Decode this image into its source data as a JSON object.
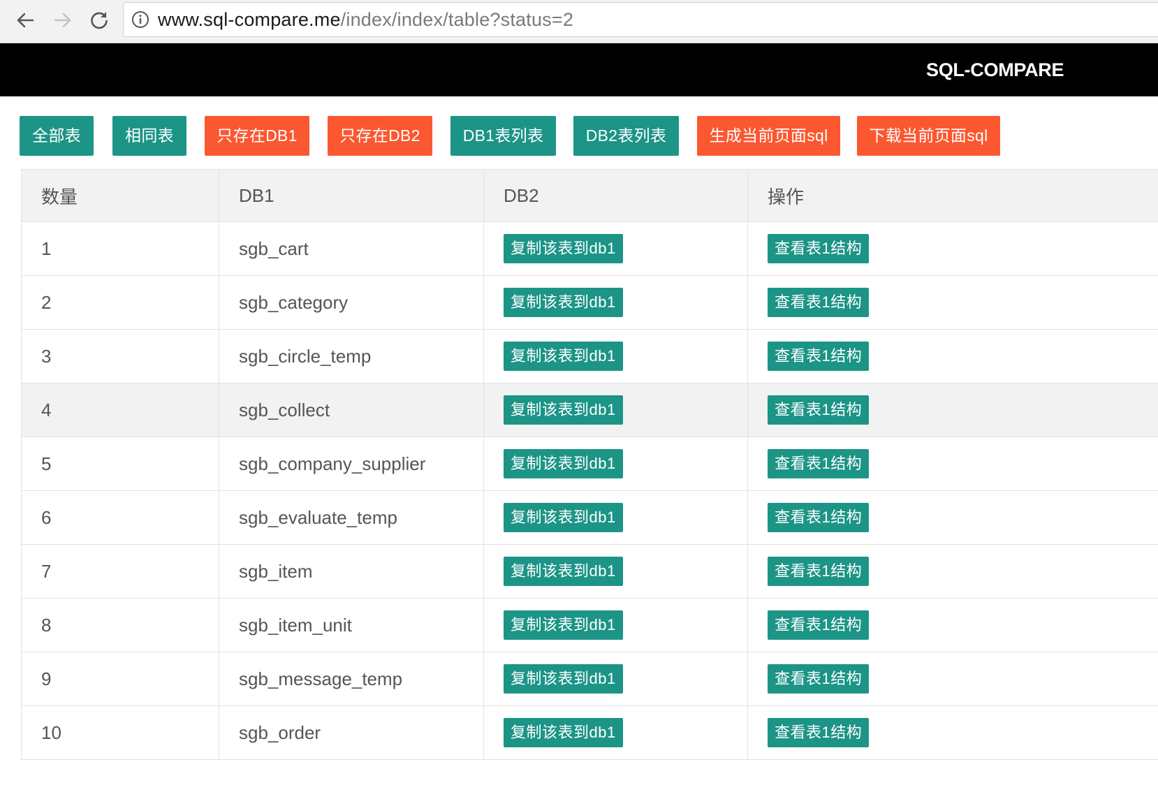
{
  "browser": {
    "url_host": "www.sql-compare.me",
    "url_path": "/index/index/table?status=2"
  },
  "header": {
    "brand": "SQL-COMPARE"
  },
  "toolbar": {
    "buttons": [
      {
        "label": "全部表",
        "color": "#1c9486"
      },
      {
        "label": "相同表",
        "color": "#1c9486"
      },
      {
        "label": "只存在DB1",
        "color": "#fb5730"
      },
      {
        "label": "只存在DB2",
        "color": "#fb5730"
      },
      {
        "label": "DB1表列表",
        "color": "#1c9486"
      },
      {
        "label": "DB2表列表",
        "color": "#1c9486"
      },
      {
        "label": "生成当前页面sql",
        "color": "#fb5730"
      },
      {
        "label": "下载当前页面sql",
        "color": "#fb5730"
      }
    ]
  },
  "table": {
    "headers": [
      "数量",
      "DB1",
      "DB2",
      "操作"
    ],
    "rows": [
      {
        "num": "1",
        "db1": "sgb_cart",
        "db2_action": "复制该表到db1",
        "action": "查看表1结构"
      },
      {
        "num": "2",
        "db1": "sgb_category",
        "db2_action": "复制该表到db1",
        "action": "查看表1结构"
      },
      {
        "num": "3",
        "db1": "sgb_circle_temp",
        "db2_action": "复制该表到db1",
        "action": "查看表1结构"
      },
      {
        "num": "4",
        "db1": "sgb_collect",
        "db2_action": "复制该表到db1",
        "action": "查看表1结构"
      },
      {
        "num": "5",
        "db1": "sgb_company_supplier",
        "db2_action": "复制该表到db1",
        "action": "查看表1结构"
      },
      {
        "num": "6",
        "db1": "sgb_evaluate_temp",
        "db2_action": "复制该表到db1",
        "action": "查看表1结构"
      },
      {
        "num": "7",
        "db1": "sgb_item",
        "db2_action": "复制该表到db1",
        "action": "查看表1结构"
      },
      {
        "num": "8",
        "db1": "sgb_item_unit",
        "db2_action": "复制该表到db1",
        "action": "查看表1结构"
      },
      {
        "num": "9",
        "db1": "sgb_message_temp",
        "db2_action": "复制该表到db1",
        "action": "查看表1结构"
      },
      {
        "num": "10",
        "db1": "sgb_order",
        "db2_action": "复制该表到db1",
        "action": "查看表1结构"
      }
    ]
  },
  "colors": {
    "primary": "#1c9486",
    "warm": "#fb5730",
    "header_bg": "#000000"
  },
  "icons": {
    "back": "arrow-left-icon",
    "forward": "arrow-right-icon",
    "reload": "reload-icon",
    "info": "info-icon"
  }
}
